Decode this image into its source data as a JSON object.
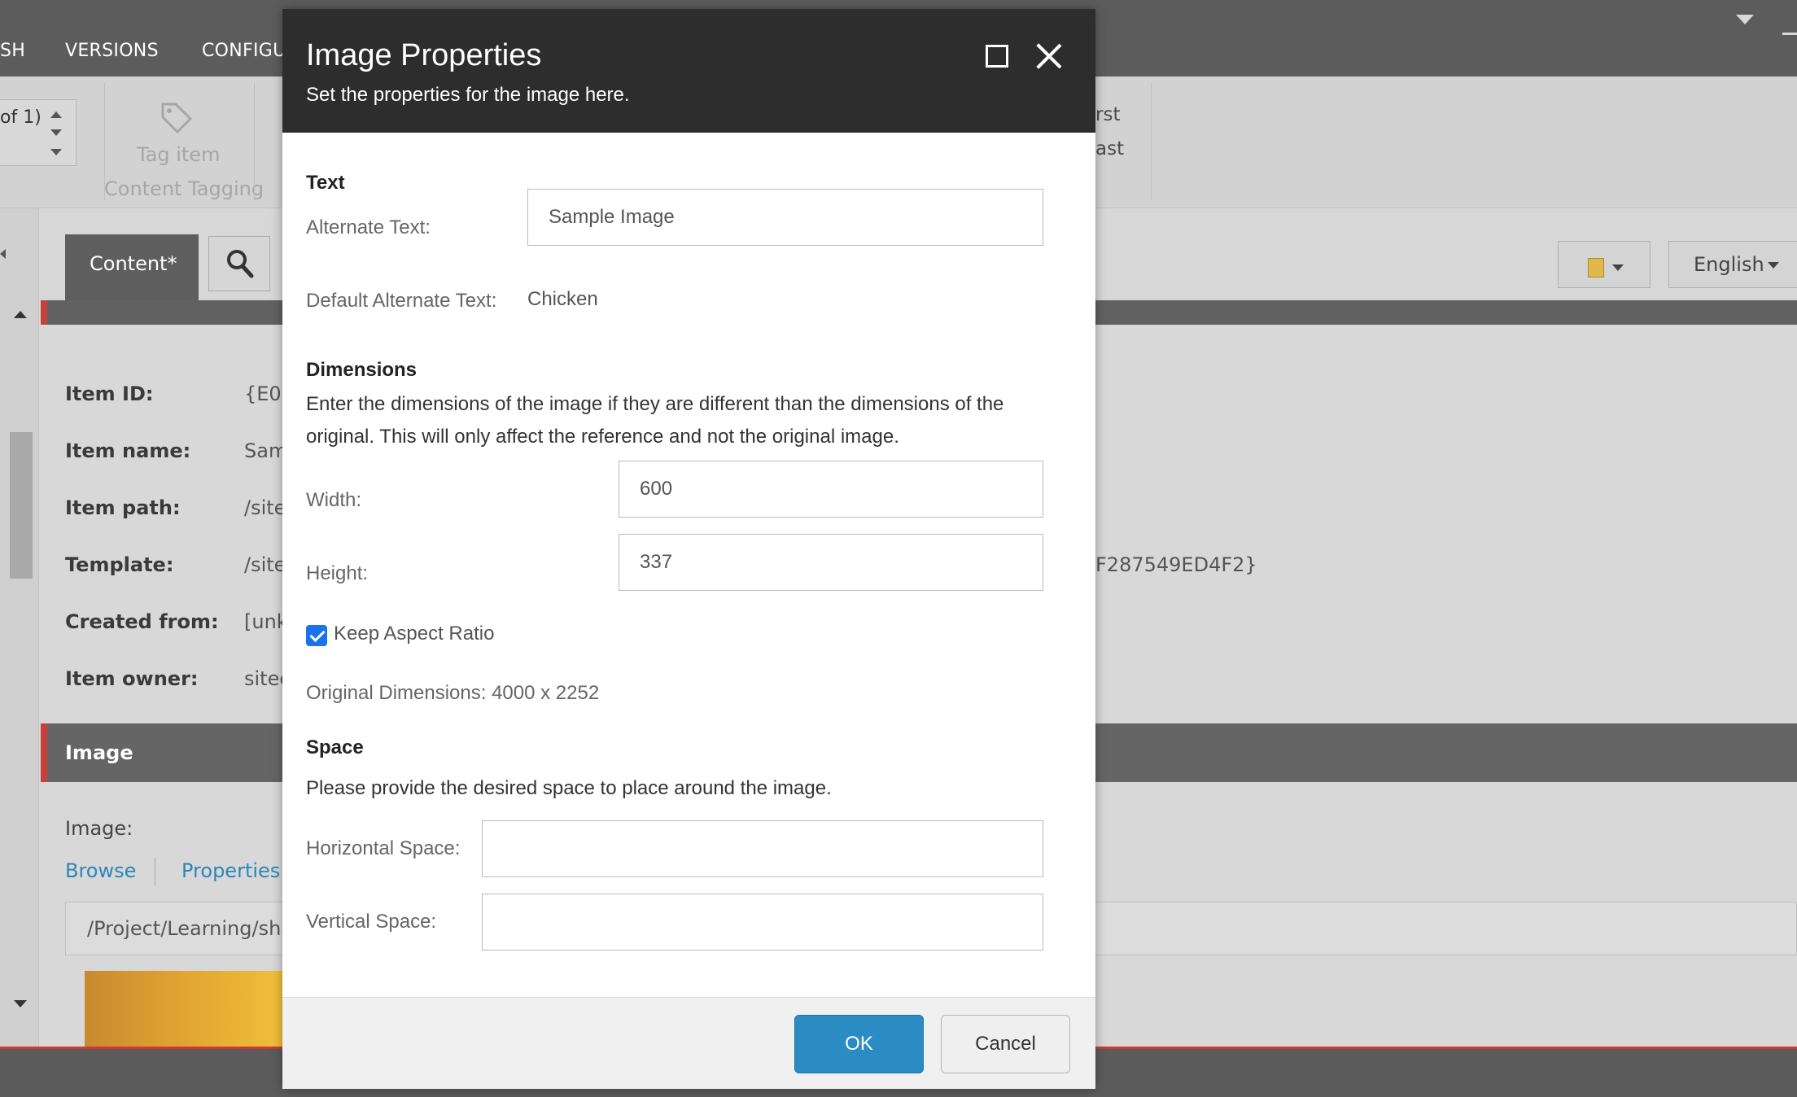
{
  "app": {
    "nav": [
      "SH",
      "VERSIONS",
      "CONFIGU"
    ],
    "ribbon": {
      "pager_text": "of 1)",
      "tag_item_label": "Tag item",
      "group_label": "Content Tagging",
      "first_label": "rst",
      "last_label": "ast"
    },
    "tabs": {
      "content_label": "Content*",
      "language": "English"
    },
    "fields": [
      {
        "label": "Item ID:",
        "value": "{E09"
      },
      {
        "label": "Item name:",
        "value": "Sam"
      },
      {
        "label": "Item path:",
        "value": "/site"
      },
      {
        "label": "Template:",
        "value": "/site"
      },
      {
        "label": "Created from:",
        "value": "[unk"
      },
      {
        "label": "Item owner:",
        "value": "sitec"
      }
    ],
    "template_id_tail": "F287549ED4F2}",
    "image_section": {
      "title": "Image",
      "field_label": "Image:",
      "browse_link": "Browse",
      "properties_link": "Properties",
      "path": "/Project/Learning/sha"
    }
  },
  "dialog": {
    "title": "Image Properties",
    "subtitle": "Set the properties for the image here.",
    "text_section": {
      "heading": "Text",
      "alt_label": "Alternate Text:",
      "alt_value": "Sample Image",
      "default_alt_label": "Default Alternate Text:",
      "default_alt_value": "Chicken"
    },
    "dimensions_section": {
      "heading": "Dimensions",
      "description": "Enter the dimensions of the image if they are different than the dimensions of the original. This will only affect the reference and not the original image.",
      "width_label": "Width:",
      "width_value": "600",
      "height_label": "Height:",
      "height_value": "337",
      "keep_aspect_label": "Keep Aspect Ratio",
      "keep_aspect_checked": true,
      "original_dimensions": "Original Dimensions: 4000 x 2252"
    },
    "space_section": {
      "heading": "Space",
      "description": "Please provide the desired space to place around the image.",
      "horizontal_label": "Horizontal Space:",
      "horizontal_value": "",
      "vertical_label": "Vertical Space:",
      "vertical_value": ""
    },
    "buttons": {
      "ok": "OK",
      "cancel": "Cancel"
    }
  },
  "colors": {
    "header_bg": "#2d2d2d",
    "ok_button": "#2b8cc4",
    "section_accent": "#c9403a",
    "link": "#2a87b8",
    "checkbox": "#1a73e8"
  },
  "icons": [
    "tag-icon",
    "search-icon",
    "maximize-icon",
    "close-icon",
    "book-icon",
    "chevron-down-icon"
  ]
}
